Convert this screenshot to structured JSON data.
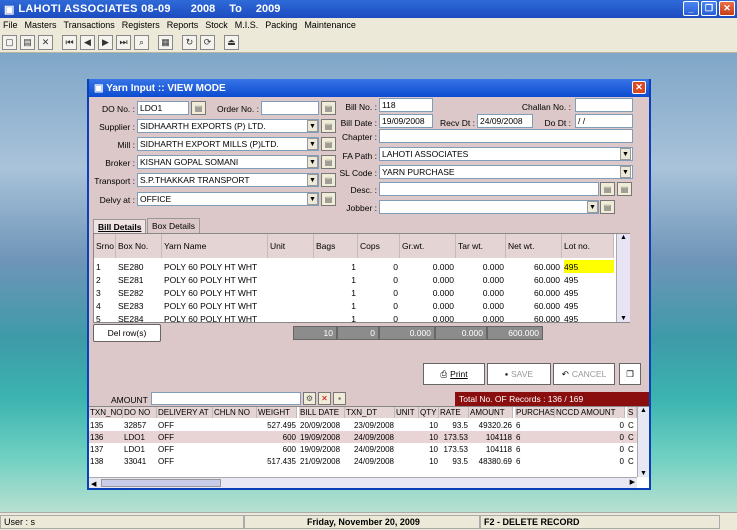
{
  "app": {
    "title": "LAHOTI ASSOCIATES 08-09",
    "year_from": "2008",
    "year_to_label": "To",
    "year_to": "2009"
  },
  "menu": [
    "File",
    "Masters",
    "Transactions",
    "Registers",
    "Reports",
    "Stock",
    "M.I.S.",
    "Packing",
    "Maintenance"
  ],
  "dialog": {
    "title": "Yarn Input :: VIEW MODE",
    "do_no_label": "DO No. :",
    "do_no": "LDO1",
    "order_no_label": "Order No. :",
    "order_no": "",
    "supplier_label": "Supplier :",
    "supplier": "SIDHAARTH EXPORTS (P) LTD.",
    "mill_label": "Mill :",
    "mill": "SIDHARTH EXPORT MILLS (P)LTD.",
    "broker_label": "Broker :",
    "broker": "KISHAN GOPAL SOMANI",
    "transport_label": "Transport :",
    "transport": "S.P.THAKKAR TRANSPORT",
    "delvy_label": "Delvy at :",
    "delvy": "OFFICE",
    "bill_no_label": "Bill No. :",
    "bill_no": "118",
    "challan_label": "Challan No. :",
    "challan": "",
    "bill_date_label": "Bill Date :",
    "bill_date": "19/09/2008",
    "recv_label": "Recv Dt :",
    "recv": "24/09/2008",
    "do_dt_label": "Do Dt :",
    "do_dt": "  /  /",
    "chapter_label": "Chapter :",
    "chapter": "",
    "fa_path_label": "FA Path :",
    "fa_path": "LAHOTI ASSOCIATES",
    "sl_code_label": "SL Code :",
    "sl_code": "YARN PURCHASE",
    "desc_label": "Desc. :",
    "desc": "",
    "jobber_label": "Jobber :",
    "jobber": "",
    "tabs": [
      "Bill Details",
      "Box Details"
    ]
  },
  "grid": {
    "headers": [
      "Srno",
      "Box No.",
      "Yarn Name",
      "Unit",
      "Bags",
      "Cops",
      "Gr.wt.",
      "Tar wt.",
      "Net wt.",
      "Lot no."
    ],
    "rows": [
      [
        "1",
        "SE280",
        "POLY 60 POLY HT WHT",
        "",
        "1",
        "0",
        "0.000",
        "0.000",
        "60.000",
        "495"
      ],
      [
        "2",
        "SE281",
        "POLY 60 POLY HT WHT",
        "",
        "1",
        "0",
        "0.000",
        "0.000",
        "60.000",
        "495"
      ],
      [
        "3",
        "SE282",
        "POLY 60 POLY HT WHT",
        "",
        "1",
        "0",
        "0.000",
        "0.000",
        "60.000",
        "495"
      ],
      [
        "4",
        "SE283",
        "POLY 60 POLY HT WHT",
        "",
        "1",
        "0",
        "0.000",
        "0.000",
        "60.000",
        "495"
      ],
      [
        "5",
        "SE284",
        "POLY 60 POLY HT WHT",
        "",
        "1",
        "0",
        "0.000",
        "0.000",
        "60.000",
        "495"
      ]
    ],
    "totals": [
      "10",
      "0",
      "0.000",
      "0.000",
      "600.000"
    ],
    "del_row": "Del row(s)"
  },
  "buttons": {
    "print": "Print",
    "save": "SAVE",
    "cancel": "CANCEL"
  },
  "lower": {
    "amount_label": "AMOUNT",
    "records": "Total No. OF Records : 136 / 169",
    "headers": [
      "TXN_NO",
      "DO NO",
      "DELIVERY AT",
      "CHLN NO",
      "WEIGHT",
      "BILL DATE",
      "TXN_DT",
      "UNIT",
      "QTY",
      "RATE",
      "AMOUNT",
      "PURCHASE",
      "NCCD AMOUNT",
      "S"
    ],
    "rows": [
      [
        "135",
        "32857",
        "OFF",
        "",
        "527.495",
        "20/09/2008",
        "23/09/2008",
        "",
        "10",
        "93.5",
        "49320.26",
        "6",
        "0",
        "C"
      ],
      [
        "136",
        "LDO1",
        "OFF",
        "",
        "600",
        "19/09/2008",
        "24/09/2008",
        "",
        "10",
        "173.53",
        "104118",
        "6",
        "0",
        "C"
      ],
      [
        "137",
        "LDO1",
        "OFF",
        "",
        "600",
        "19/09/2008",
        "24/09/2008",
        "",
        "10",
        "173.53",
        "104118",
        "6",
        "0",
        "C"
      ],
      [
        "138",
        "33041",
        "OFF",
        "",
        "517.435",
        "21/09/2008",
        "24/09/2008",
        "",
        "10",
        "93.5",
        "48380.69",
        "6",
        "0",
        "C"
      ]
    ]
  },
  "status": {
    "user": "User : s",
    "date": "Friday, November 20, 2009",
    "hint": "F2 - DELETE RECORD"
  }
}
